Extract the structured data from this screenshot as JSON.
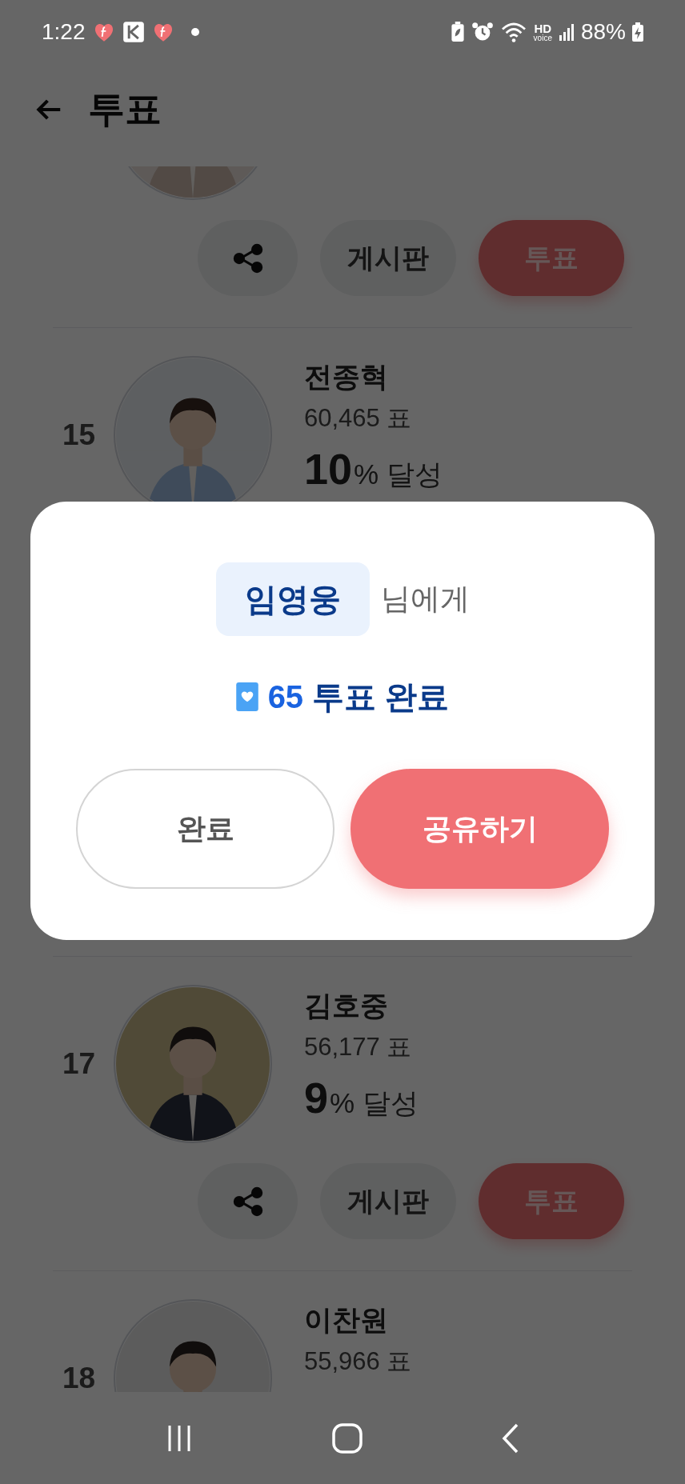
{
  "status_bar": {
    "time": "1:22",
    "network_badge": [
      "HD",
      "voice"
    ],
    "battery": "88%"
  },
  "header": {
    "title": "투표"
  },
  "candidates": [
    {
      "kind": "candidate",
      "actions": {
        "board": "게시판",
        "vote": "투표"
      }
    },
    {
      "kind": "candidate",
      "rank": "15",
      "name": "전종혁",
      "votes": "60,465 표",
      "achievement_value": "10",
      "achievement_unit": "% 달성"
    },
    {
      "kind": "covered"
    },
    {
      "kind": "candidate",
      "rank": "17",
      "name": "김호중",
      "votes": "56,177 표",
      "achievement_value": "9",
      "achievement_unit": "% 달성",
      "actions": {
        "board": "게시판",
        "vote": "투표"
      }
    },
    {
      "kind": "candidate",
      "rank": "18",
      "name": "이찬원",
      "votes": "55,966 표"
    }
  ],
  "dialog": {
    "recipient": "임영웅",
    "recipient_suffix": "님에게",
    "count": "65",
    "message": "투표 완료",
    "buttons": [
      {
        "label": "완료",
        "kind": "secondary"
      },
      {
        "label": "공유하기",
        "kind": "primary"
      }
    ]
  }
}
